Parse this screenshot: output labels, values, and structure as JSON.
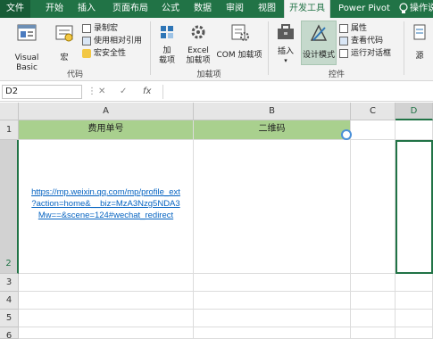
{
  "ribbon_tabs": [
    "文件",
    "开始",
    "插入",
    "页面布局",
    "公式",
    "数据",
    "审阅",
    "视图",
    "开发工具",
    "Power Pivot",
    "操作说"
  ],
  "ribbon": {
    "code": {
      "visual_basic": "Visual Basic",
      "macros": "宏",
      "record_macro": "录制宏",
      "relative_refs": "使用相对引用",
      "macro_security": "宏安全性",
      "group_label": "代码"
    },
    "addins": {
      "addins_line1": "加",
      "addins_line2": "载项",
      "excel_addins_line1": "Excel",
      "excel_addins_line2": "加载项",
      "com_addins": "COM 加载项",
      "group_label": "加载项"
    },
    "controls": {
      "insert": "插入",
      "design_mode": "设计模式",
      "properties": "属性",
      "view_code": "查看代码",
      "run_dialog": "运行对话框",
      "group_label": "控件"
    },
    "source": "源"
  },
  "formula_bar": {
    "name_box": "D2",
    "more": "⋮",
    "cancel": "✕",
    "enter": "✓",
    "fx": "fx",
    "value": ""
  },
  "columns": [
    "A",
    "B",
    "C",
    "D"
  ],
  "rows": [
    "1",
    "2",
    "3",
    "4",
    "5",
    "6"
  ],
  "cells": {
    "A1": "费用单号",
    "B1": "二维码",
    "A2_line1": "https://mp.weixin.qq.com/mp/profile_ext",
    "A2_line2": "?action=home&__biz=MzA3Nzg5NDA3",
    "A2_line3": "Mw==&scene=124#wechat_redirect"
  },
  "colors": {
    "ribbon_green": "#217346",
    "header_fill": "#a9d08e",
    "link": "#0563c1"
  }
}
